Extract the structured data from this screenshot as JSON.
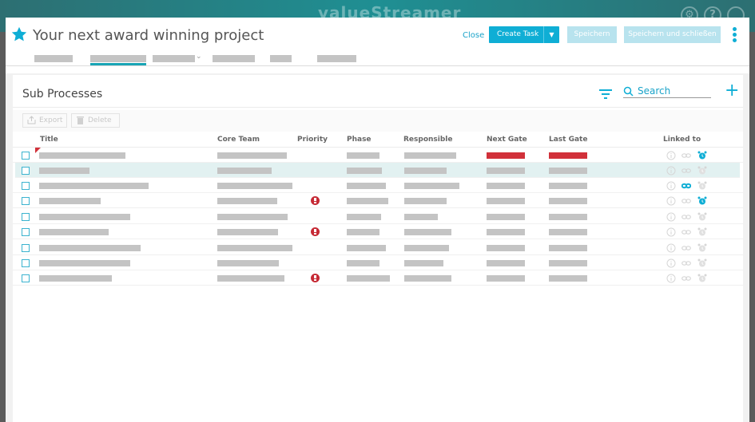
{
  "app": {
    "logo_text": "valueStreamer"
  },
  "header": {
    "title": "Your next award winning project",
    "close_label": "Close",
    "create_task_label": "Create Task",
    "save_label": "Speichern",
    "save_close_label": "Speichern und schließen"
  },
  "section": {
    "title": "Sub Processes",
    "search_label": "Search",
    "export_label": "Export",
    "delete_label": "Delete"
  },
  "table": {
    "columns": [
      "Title",
      "Core Team",
      "Priority",
      "Phase",
      "Responsible",
      "Next Gate",
      "Last Gate",
      "Linked to"
    ],
    "rows": [
      {
        "selected": false,
        "priority": false,
        "next_gate_status": "red",
        "last_gate_status": "red",
        "info_active": false,
        "link_active": false,
        "alarm_active": true
      },
      {
        "selected": true,
        "priority": false,
        "next_gate_status": "grey",
        "last_gate_status": "grey",
        "info_active": false,
        "link_active": false,
        "alarm_active": false
      },
      {
        "selected": false,
        "priority": false,
        "next_gate_status": "grey",
        "last_gate_status": "grey",
        "info_active": false,
        "link_active": true,
        "alarm_active": false
      },
      {
        "selected": false,
        "priority": true,
        "next_gate_status": "grey",
        "last_gate_status": "grey",
        "info_active": false,
        "link_active": false,
        "alarm_active": true
      },
      {
        "selected": false,
        "priority": false,
        "next_gate_status": "grey",
        "last_gate_status": "grey",
        "info_active": false,
        "link_active": false,
        "alarm_active": false
      },
      {
        "selected": false,
        "priority": true,
        "next_gate_status": "grey",
        "last_gate_status": "grey",
        "info_active": false,
        "link_active": false,
        "alarm_active": false
      },
      {
        "selected": false,
        "priority": false,
        "next_gate_status": "grey",
        "last_gate_status": "grey",
        "info_active": false,
        "link_active": false,
        "alarm_active": false
      },
      {
        "selected": false,
        "priority": false,
        "next_gate_status": "grey",
        "last_gate_status": "grey",
        "info_active": false,
        "link_active": false,
        "alarm_active": false
      },
      {
        "selected": false,
        "priority": true,
        "next_gate_status": "grey",
        "last_gate_status": "grey",
        "info_active": false,
        "link_active": false,
        "alarm_active": false
      }
    ]
  },
  "colors": {
    "accent": "#0faed5",
    "teal_header": "#1f8f93",
    "status_red": "#d1313a",
    "placeholder_grey": "#c4c4c4"
  },
  "icons": [
    "star-icon",
    "filter-icon",
    "search-icon",
    "plus-icon",
    "export-icon",
    "trash-icon",
    "info-icon",
    "link-icon",
    "alarm-icon",
    "kebab-menu-icon",
    "settings-icon",
    "help-icon"
  ]
}
